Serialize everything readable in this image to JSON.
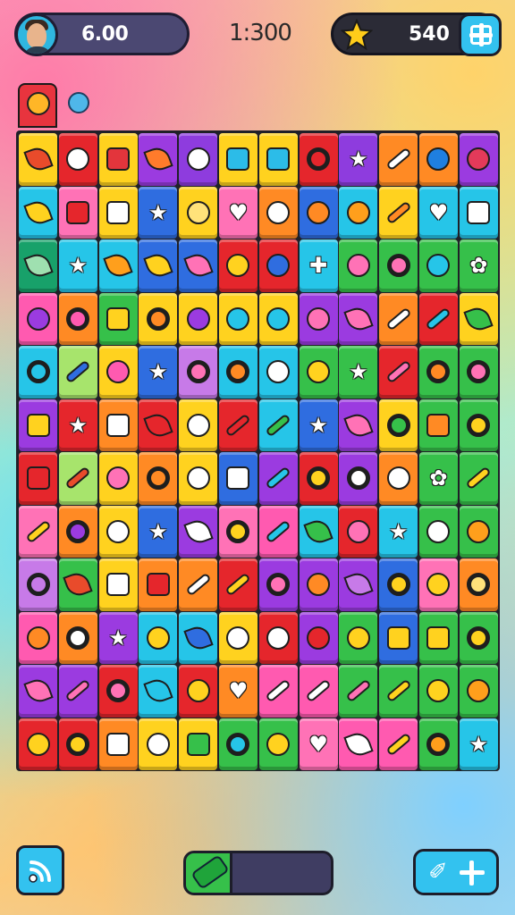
{
  "hud": {
    "player_value": "6.00",
    "timer": "1:300",
    "stars_value": "540"
  },
  "icons": {
    "avatar": "avatar",
    "star": "star-icon",
    "shop": "plus-icon",
    "signal": "signal-icon",
    "progress_icon": "pencil-icon",
    "pin": "pin-icon",
    "add": "plus-icon"
  },
  "tabs": [
    {
      "name": "gift-tab",
      "color": "#e8343e"
    },
    {
      "name": "orb-tab",
      "color": "#4fb7e9"
    }
  ],
  "progress": {
    "fraction": 0.32
  },
  "board": {
    "rows": [
      [
        [
          "#ffd21f",
          "leaf",
          "#e94b2b"
        ],
        [
          "#e5262c",
          "circle",
          "#ffffff"
        ],
        [
          "#ffd21f",
          "square",
          "#e3353c"
        ],
        [
          "#9b3be0",
          "leaf",
          "#ff7b2b"
        ],
        [
          "#8e3cde",
          "circle",
          "#ffffff"
        ],
        [
          "#ffd21f",
          "square",
          "#2cbce8"
        ],
        [
          "#ffd21f",
          "square",
          "#2cbce8"
        ],
        [
          "#e5262c",
          "ring",
          "#e5262c"
        ],
        [
          "#8e3cde",
          "glyph",
          "★"
        ],
        [
          "#ff8a24",
          "bolt",
          "#ffffff"
        ],
        [
          "#ff8a24",
          "circle",
          "#1f7fe0"
        ],
        [
          "#9b3be0",
          "circle",
          "#e33a5a"
        ]
      ],
      [
        [
          "#26c5e8",
          "leaf",
          "#ffd21f"
        ],
        [
          "#ff72b6",
          "square",
          "#e5262c"
        ],
        [
          "#ffd21f",
          "square",
          "#ffffff"
        ],
        [
          "#2f6de0",
          "glyph",
          "★"
        ],
        [
          "#ffd21f",
          "circle",
          "#ffe27a"
        ],
        [
          "#ff72b6",
          "glyph",
          "♥"
        ],
        [
          "#ff8a24",
          "circle",
          "#ffffff"
        ],
        [
          "#2f6de0",
          "circle",
          "#ff8a24"
        ],
        [
          "#26c5e8",
          "circle",
          "#ff9f1c"
        ],
        [
          "#ffd21f",
          "bolt",
          "#ff8a24"
        ],
        [
          "#26c5e8",
          "glyph",
          "♥"
        ],
        [
          "#26c5e8",
          "square",
          "#ffffff"
        ]
      ],
      [
        [
          "#18a16a",
          "leaf",
          "#9fe0b0"
        ],
        [
          "#26c5e8",
          "glyph",
          "★"
        ],
        [
          "#26c5e8",
          "leaf",
          "#ff9f1c"
        ],
        [
          "#2f6de0",
          "leaf",
          "#ffd21f"
        ],
        [
          "#2f6de0",
          "leaf",
          "#ff72b6"
        ],
        [
          "#e5262c",
          "circle",
          "#ffd21f"
        ],
        [
          "#e5262c",
          "circle",
          "#2f6de0"
        ],
        [
          "#26c5e8",
          "glyph",
          "✚"
        ],
        [
          "#36c04a",
          "circle",
          "#ff72b6"
        ],
        [
          "#36c04a",
          "ring",
          "#ff72b6"
        ],
        [
          "#36c04a",
          "circle",
          "#26c5e8"
        ],
        [
          "#36c04a",
          "glyph",
          "✿"
        ]
      ],
      [
        [
          "#ff5ab0",
          "circle",
          "#9b3be0"
        ],
        [
          "#ff8a24",
          "ring",
          "#ff5ab0"
        ],
        [
          "#36c04a",
          "square",
          "#ffd21f"
        ],
        [
          "#ffd21f",
          "ring",
          "#ff8a24"
        ],
        [
          "#ffd21f",
          "circle",
          "#9b3be0"
        ],
        [
          "#ffd21f",
          "circle",
          "#26c5e8"
        ],
        [
          "#ffd21f",
          "circle",
          "#26c5e8"
        ],
        [
          "#9b3be0",
          "circle",
          "#ff72b6"
        ],
        [
          "#9b3be0",
          "leaf",
          "#ff72b6"
        ],
        [
          "#ff8a24",
          "bolt",
          "#ffffff"
        ],
        [
          "#e5262c",
          "bolt",
          "#26c5e8"
        ],
        [
          "#ffd21f",
          "leaf",
          "#36c04a"
        ]
      ],
      [
        [
          "#26c5e8",
          "ring",
          "#26c5e8"
        ],
        [
          "#a7e46c",
          "bolt",
          "#2f6de0"
        ],
        [
          "#ffd21f",
          "circle",
          "#ff5ab0"
        ],
        [
          "#2f6de0",
          "glyph",
          "★"
        ],
        [
          "#c77ae8",
          "ring",
          "#ff72b6"
        ],
        [
          "#26c5e8",
          "ring",
          "#ff8a24"
        ],
        [
          "#26c5e8",
          "circle",
          "#ffffff"
        ],
        [
          "#36c04a",
          "circle",
          "#ffd21f"
        ],
        [
          "#36c04a",
          "glyph",
          "★"
        ],
        [
          "#e5262c",
          "bolt",
          "#ff72b6"
        ],
        [
          "#36c04a",
          "ring",
          "#ff8a24"
        ],
        [
          "#36c04a",
          "ring",
          "#ff72b6"
        ]
      ],
      [
        [
          "#9b3be0",
          "square",
          "#ffd21f"
        ],
        [
          "#e5262c",
          "glyph",
          "★"
        ],
        [
          "#ff8a24",
          "square",
          "#ffffff"
        ],
        [
          "#e5262c",
          "leaf",
          "#e5262c"
        ],
        [
          "#ffd21f",
          "circle",
          "#ffffff"
        ],
        [
          "#e5262c",
          "bolt",
          "#e5262c"
        ],
        [
          "#26c5e8",
          "bolt",
          "#36c04a"
        ],
        [
          "#2f6de0",
          "glyph",
          "★"
        ],
        [
          "#9b3be0",
          "leaf",
          "#ff72b6"
        ],
        [
          "#ffd21f",
          "ring",
          "#36c04a"
        ],
        [
          "#36c04a",
          "square",
          "#ff8a24"
        ],
        [
          "#36c04a",
          "ring",
          "#ffd21f"
        ]
      ],
      [
        [
          "#e5262c",
          "square",
          "#e5262c"
        ],
        [
          "#a7e46c",
          "bolt",
          "#e94b2b"
        ],
        [
          "#ffd21f",
          "circle",
          "#ff72b6"
        ],
        [
          "#ff8a24",
          "ring",
          "#ff8a24"
        ],
        [
          "#ffd21f",
          "circle",
          "#ffffff"
        ],
        [
          "#2f6de0",
          "square",
          "#ffffff"
        ],
        [
          "#9b3be0",
          "bolt",
          "#26c5e8"
        ],
        [
          "#e5262c",
          "ring",
          "#ffd21f"
        ],
        [
          "#9b3be0",
          "ring",
          "#ffffff"
        ],
        [
          "#ff8a24",
          "circle",
          "#ffffff"
        ],
        [
          "#36c04a",
          "glyph",
          "✿"
        ],
        [
          "#36c04a",
          "bolt",
          "#ffd21f"
        ]
      ],
      [
        [
          "#ff72b6",
          "bolt",
          "#ffd21f"
        ],
        [
          "#ff8a24",
          "ring",
          "#9b3be0"
        ],
        [
          "#ffd21f",
          "circle",
          "#ffffff"
        ],
        [
          "#2f6de0",
          "glyph",
          "★"
        ],
        [
          "#9b3be0",
          "leaf",
          "#ffffff"
        ],
        [
          "#ff72b6",
          "ring",
          "#ffd21f"
        ],
        [
          "#ff5ab0",
          "bolt",
          "#26c5e8"
        ],
        [
          "#26c5e8",
          "leaf",
          "#36c04a"
        ],
        [
          "#e5262c",
          "circle",
          "#ff72b6"
        ],
        [
          "#26c5e8",
          "glyph",
          "★"
        ],
        [
          "#36c04a",
          "circle",
          "#ffffff"
        ],
        [
          "#36c04a",
          "circle",
          "#ff9f1c"
        ]
      ],
      [
        [
          "#c77ae8",
          "ring",
          "#c77ae8"
        ],
        [
          "#36c04a",
          "leaf",
          "#e94b2b"
        ],
        [
          "#ffd21f",
          "square",
          "#ffffff"
        ],
        [
          "#ff8a24",
          "square",
          "#e5262c"
        ],
        [
          "#ff8a24",
          "bolt",
          "#ffffff"
        ],
        [
          "#e5262c",
          "bolt",
          "#ffd21f"
        ],
        [
          "#9b3be0",
          "ring",
          "#ff72b6"
        ],
        [
          "#9b3be0",
          "circle",
          "#ff8a24"
        ],
        [
          "#9b3be0",
          "leaf",
          "#c77ae8"
        ],
        [
          "#2f6de0",
          "ring",
          "#ffd21f"
        ],
        [
          "#ff72b6",
          "circle",
          "#ffd21f"
        ],
        [
          "#ff8a24",
          "ring",
          "#ffe27a"
        ]
      ],
      [
        [
          "#ff5ab0",
          "circle",
          "#ff8a24"
        ],
        [
          "#ff8a24",
          "ring",
          "#ffffff"
        ],
        [
          "#9b3be0",
          "glyph",
          "★"
        ],
        [
          "#26c5e8",
          "circle",
          "#ffd21f"
        ],
        [
          "#26c5e8",
          "leaf",
          "#2f6de0"
        ],
        [
          "#ffd21f",
          "circle",
          "#ffffff"
        ],
        [
          "#e5262c",
          "circle",
          "#ffffff"
        ],
        [
          "#9b3be0",
          "circle",
          "#e5262c"
        ],
        [
          "#36c04a",
          "circle",
          "#ffd21f"
        ],
        [
          "#2f6de0",
          "square",
          "#ffd21f"
        ],
        [
          "#36c04a",
          "square",
          "#ffd21f"
        ],
        [
          "#36c04a",
          "ring",
          "#ffd21f"
        ]
      ],
      [
        [
          "#9b3be0",
          "leaf",
          "#ff72b6"
        ],
        [
          "#9b3be0",
          "bolt",
          "#ff72b6"
        ],
        [
          "#e5262c",
          "ring",
          "#ff72b6"
        ],
        [
          "#26c5e8",
          "leaf",
          "#26c5e8"
        ],
        [
          "#e5262c",
          "circle",
          "#ffd21f"
        ],
        [
          "#ff8a24",
          "glyph",
          "♥"
        ],
        [
          "#ff5ab0",
          "bolt",
          "#ffffff"
        ],
        [
          "#ff5ab0",
          "bolt",
          "#ffffff"
        ],
        [
          "#36c04a",
          "bolt",
          "#ff72b6"
        ],
        [
          "#36c04a",
          "bolt",
          "#ffd21f"
        ],
        [
          "#36c04a",
          "circle",
          "#ffd21f"
        ],
        [
          "#36c04a",
          "circle",
          "#ff9f1c"
        ]
      ],
      [
        [
          "#e5262c",
          "circle",
          "#ffd21f"
        ],
        [
          "#e5262c",
          "ring",
          "#ffd21f"
        ],
        [
          "#ff8a24",
          "square",
          "#ffffff"
        ],
        [
          "#ffd21f",
          "circle",
          "#ffffff"
        ],
        [
          "#ffd21f",
          "square",
          "#36c04a"
        ],
        [
          "#36c04a",
          "ring",
          "#26c5e8"
        ],
        [
          "#36c04a",
          "circle",
          "#ffd21f"
        ],
        [
          "#ff72b6",
          "glyph",
          "♥"
        ],
        [
          "#ff5ab0",
          "leaf",
          "#ffffff"
        ],
        [
          "#ff5ab0",
          "bolt",
          "#ffd21f"
        ],
        [
          "#36c04a",
          "ring",
          "#ff9f1c"
        ],
        [
          "#26c5e8",
          "glyph",
          "★"
        ]
      ]
    ]
  }
}
